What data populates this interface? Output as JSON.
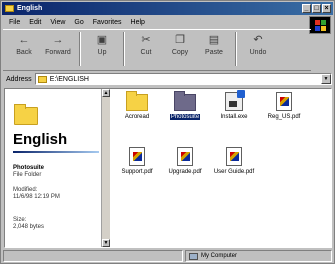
{
  "window": {
    "title": "English"
  },
  "menu": [
    "File",
    "Edit",
    "View",
    "Go",
    "Favorites",
    "Help"
  ],
  "toolbar": [
    {
      "label": "Back",
      "icon": "back-arrow-icon"
    },
    {
      "label": "Forward",
      "icon": "forward-arrow-icon"
    },
    {
      "label": "Up",
      "icon": "up-folder-icon"
    },
    {
      "label": "Cut",
      "icon": "scissors-icon"
    },
    {
      "label": "Copy",
      "icon": "copy-icon"
    },
    {
      "label": "Paste",
      "icon": "paste-icon"
    },
    {
      "label": "Undo",
      "icon": "undo-icon"
    }
  ],
  "address": {
    "label": "Address",
    "value": "E:\\ENGLISH"
  },
  "left_panel": {
    "folder_name": "English",
    "selected_name": "Photosuite",
    "selected_type": "File Folder",
    "modified_label": "Modified:",
    "modified_value": "11/6/98 12:19 PM",
    "size_label": "Size:",
    "size_value": "2,048 bytes"
  },
  "files": [
    {
      "name": "Acroread",
      "type": "folder"
    },
    {
      "name": "Photosuite",
      "type": "folder-selected"
    },
    {
      "name": "Install.exe",
      "type": "exe"
    },
    {
      "name": "Reg_US.pdf",
      "type": "pdf"
    },
    {
      "name": "Support.pdf",
      "type": "pdf"
    },
    {
      "name": "Upgrade.pdf",
      "type": "pdf"
    },
    {
      "name": "User Guide.pdf",
      "type": "pdf"
    }
  ],
  "status": {
    "location": "My Computer"
  }
}
